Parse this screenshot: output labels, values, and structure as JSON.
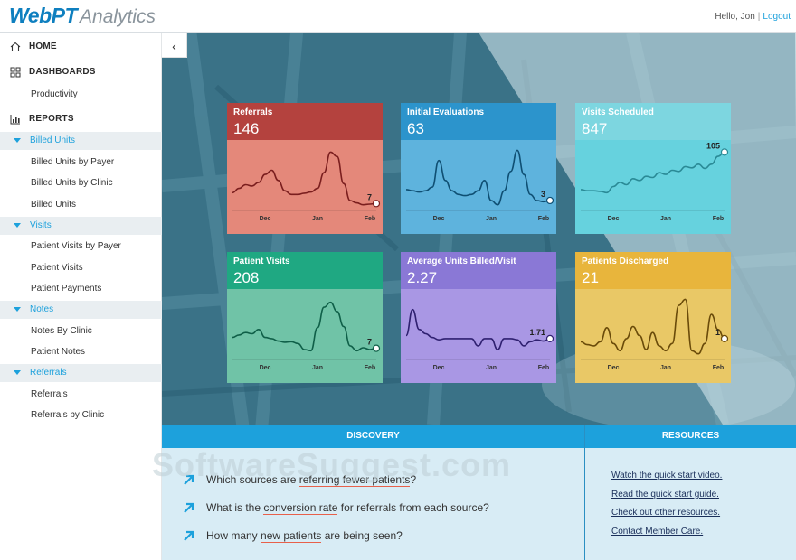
{
  "header": {
    "brand": "WebPT",
    "product": "Analytics",
    "greeting": "Hello, Jon",
    "separator": "|",
    "logout": "Logout"
  },
  "sidebar": {
    "collapse_glyph": "‹",
    "home": "HOME",
    "dashboards": "DASHBOARDS",
    "productivity": "Productivity",
    "reports": "REPORTS",
    "sections": [
      {
        "label": "Billed Units",
        "items": [
          "Billed Units by Payer",
          "Billed Units by Clinic",
          "Billed Units"
        ]
      },
      {
        "label": "Visits",
        "items": [
          "Patient Visits by Payer",
          "Patient Visits",
          "Patient Payments"
        ]
      },
      {
        "label": "Notes",
        "items": [
          "Notes By Clinic",
          "Patient Notes"
        ]
      },
      {
        "label": "Referrals",
        "items": [
          "Referrals",
          "Referrals by Clinic"
        ]
      }
    ]
  },
  "cards": [
    {
      "title": "Referrals",
      "value": "146",
      "last_label": "7",
      "head_color": "#b4423e",
      "body_color": "#e4887a",
      "line_color": "#7a1e1e",
      "ticks": [
        "Dec",
        "Jan",
        "Feb"
      ],
      "trend": [
        0.25,
        0.32,
        0.38,
        0.36,
        0.42,
        0.55,
        0.62,
        0.45,
        0.28,
        0.22,
        0.22,
        0.24,
        0.26,
        0.32,
        0.58,
        0.92,
        0.85,
        0.4,
        0.12,
        0.08,
        0.05,
        0.06,
        0.07
      ]
    },
    {
      "title": "Initial Evaluations",
      "value": "63",
      "last_label": "3",
      "head_color": "#2c94cc",
      "body_color": "#5eb3dd",
      "line_color": "#0f4f73",
      "ticks": [
        "Dec",
        "Jan",
        "Feb"
      ],
      "trend": [
        0.3,
        0.28,
        0.26,
        0.28,
        0.34,
        0.78,
        0.45,
        0.28,
        0.22,
        0.2,
        0.22,
        0.28,
        0.45,
        0.12,
        0.05,
        0.28,
        0.6,
        0.95,
        0.55,
        0.22,
        0.12,
        0.1,
        0.12
      ]
    },
    {
      "title": "Visits Scheduled",
      "value": "847",
      "last_label": "105",
      "head_color": "#7dd6e0",
      "body_color": "#66d2de",
      "line_color": "#2a8a96",
      "ticks": [
        "Dec",
        "Jan",
        "Feb"
      ],
      "trend": [
        0.3,
        0.28,
        0.28,
        0.27,
        0.25,
        0.35,
        0.42,
        0.38,
        0.48,
        0.45,
        0.52,
        0.5,
        0.58,
        0.55,
        0.62,
        0.6,
        0.68,
        0.66,
        0.72,
        0.65,
        0.72,
        0.85,
        0.92
      ]
    },
    {
      "title": "Patient Visits",
      "value": "208",
      "last_label": "7",
      "head_color": "#1fa882",
      "body_color": "#70c3a7",
      "line_color": "#0f5f48",
      "ticks": [
        "Dec",
        "Jan",
        "Feb"
      ],
      "trend": [
        0.32,
        0.36,
        0.4,
        0.38,
        0.45,
        0.32,
        0.3,
        0.26,
        0.24,
        0.25,
        0.22,
        0.12,
        0.1,
        0.48,
        0.82,
        0.9,
        0.75,
        0.5,
        0.18,
        0.1,
        0.15,
        0.12,
        0.14
      ]
    },
    {
      "title": "Average Units Billed/Visit",
      "value": "2.27",
      "last_label": "1.71",
      "head_color": "#8a78d6",
      "body_color": "#a997e4",
      "line_color": "#2f2070",
      "ticks": [
        "Dec",
        "Jan",
        "Feb"
      ],
      "trend": [
        0.35,
        0.78,
        0.45,
        0.38,
        0.32,
        0.28,
        0.3,
        0.3,
        0.3,
        0.3,
        0.3,
        0.18,
        0.3,
        0.3,
        0.12,
        0.3,
        0.3,
        0.28,
        0.18,
        0.25,
        0.28,
        0.26,
        0.3
      ]
    },
    {
      "title": "Patients Discharged",
      "value": "21",
      "last_label": "1",
      "head_color": "#e8b53c",
      "body_color": "#e9c866",
      "line_color": "#6a4b0a",
      "ticks": [
        "Dec",
        "Jan",
        "Feb"
      ],
      "trend": [
        0.25,
        0.2,
        0.18,
        0.25,
        0.48,
        0.22,
        0.1,
        0.3,
        0.5,
        0.35,
        0.12,
        0.4,
        0.18,
        0.1,
        0.22,
        0.85,
        0.95,
        0.1,
        0.05,
        0.22,
        0.7,
        0.45,
        0.3
      ]
    }
  ],
  "discovery": {
    "heading": "DISCOVERY",
    "questions": [
      {
        "before": "Which sources are ",
        "emph": "referring fewer patients",
        "after": "?"
      },
      {
        "before": "What is the ",
        "emph": "conversion rate",
        "after": " for referrals from each source?"
      },
      {
        "before": "How many ",
        "emph": "new patients",
        "after": " are being seen?"
      }
    ]
  },
  "resources": {
    "heading": "RESOURCES",
    "links": [
      "Watch the quick start video.",
      "Read the quick start guide.",
      "Check out other resources.",
      "Contact Member Care."
    ]
  },
  "watermark": "SoftwareSuggest.com"
}
